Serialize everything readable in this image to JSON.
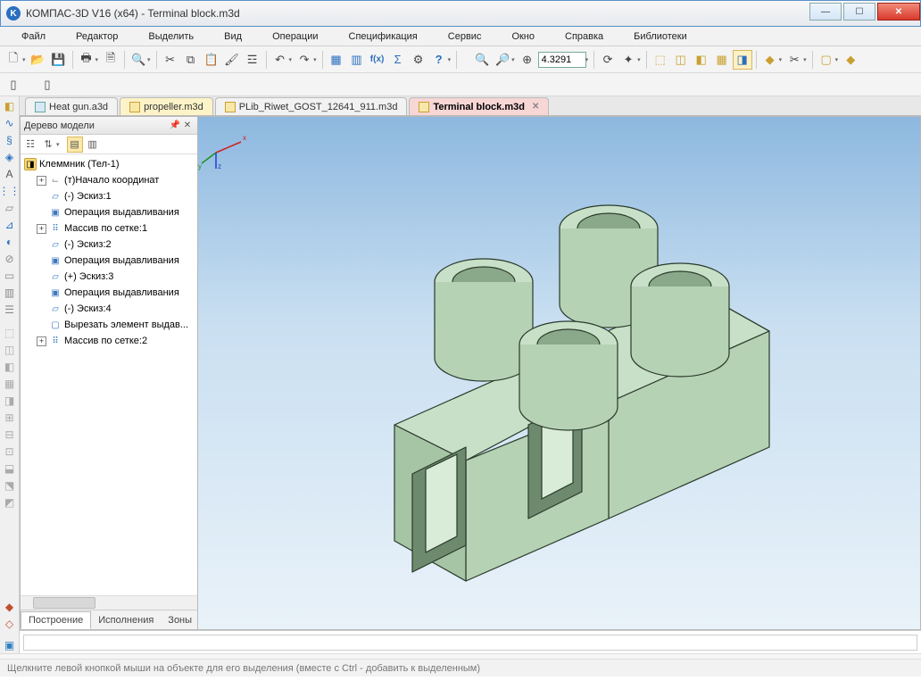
{
  "title": "КОМПАС-3D V16  (x64) - Terminal block.m3d",
  "menu": [
    "Файл",
    "Редактор",
    "Выделить",
    "Вид",
    "Операции",
    "Спецификация",
    "Сервис",
    "Окно",
    "Справка",
    "Библиотеки"
  ],
  "zoom_value": "4.3291",
  "doc_tabs": [
    {
      "label": "Heat gun.a3d",
      "kind": "plain"
    },
    {
      "label": "propeller.m3d",
      "kind": "yellow"
    },
    {
      "label": "PLib_Riwet_GOST_12641_911.m3d",
      "kind": "plain"
    },
    {
      "label": "Terminal block.m3d",
      "kind": "pink",
      "closable": true
    }
  ],
  "tree_title": "Дерево модели",
  "tree_root": "Клеммник (Тел-1)",
  "tree_items": [
    {
      "exp": "+",
      "icon": "axes",
      "label": "(т)Начало координат"
    },
    {
      "exp": "",
      "icon": "sketch",
      "label": "(-) Эскиз:1"
    },
    {
      "exp": "",
      "icon": "extrude",
      "label": "Операция выдавливания"
    },
    {
      "exp": "+",
      "icon": "array",
      "label": "Массив по сетке:1"
    },
    {
      "exp": "",
      "icon": "sketch",
      "label": "(-) Эскиз:2"
    },
    {
      "exp": "",
      "icon": "extrude",
      "label": "Операция выдавливания"
    },
    {
      "exp": "",
      "icon": "sketch",
      "label": "(+) Эскиз:3"
    },
    {
      "exp": "",
      "icon": "extrude",
      "label": "Операция выдавливания"
    },
    {
      "exp": "",
      "icon": "sketch",
      "label": "(-) Эскиз:4"
    },
    {
      "exp": "",
      "icon": "cut",
      "label": "Вырезать элемент выдав..."
    },
    {
      "exp": "+",
      "icon": "array",
      "label": "Массив по сетке:2"
    }
  ],
  "tree_bottom_tabs": [
    "Построение",
    "Исполнения",
    "Зоны"
  ],
  "status": "Щелкните левой кнопкой мыши на объекте для его выделения (вместе с Ctrl - добавить к выделенным)"
}
